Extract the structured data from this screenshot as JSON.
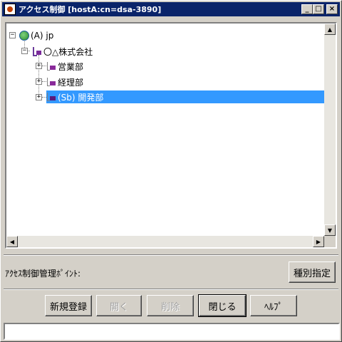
{
  "window": {
    "title": "アクセス制御 [hostA:cn=dsa-3890]",
    "minimize_glyph": "_",
    "maximize_glyph": "□",
    "close_glyph": "×"
  },
  "tree": {
    "nodes": [
      {
        "label": "(A) jp",
        "icon": "globe-icon",
        "expander": "−",
        "level": 0,
        "selected": false
      },
      {
        "label": "〇△株式会社",
        "icon": "organization-icon",
        "expander": "−",
        "level": 1,
        "selected": false
      },
      {
        "label": "営業部",
        "icon": "org-unit-icon",
        "expander": "+",
        "level": 2,
        "selected": false
      },
      {
        "label": "経理部",
        "icon": "org-unit-icon",
        "expander": "+",
        "level": 2,
        "selected": false
      },
      {
        "label": "(Sb) 開発部",
        "icon": "org-unit-icon",
        "expander": "+",
        "level": 2,
        "selected": true
      }
    ]
  },
  "scrollbar": {
    "up_glyph": "▲",
    "down_glyph": "▼",
    "left_glyph": "◀",
    "right_glyph": "▶"
  },
  "access_control": {
    "label": "ｱｸｾｽ制御管理ﾎﾟｲﾝﾄ:",
    "type_button": "種別指定"
  },
  "buttons": {
    "register": "新規登録",
    "open": "開く",
    "delete": "削除",
    "close": "閉じる",
    "help": "ﾍﾙﾌﾟ"
  },
  "status": {
    "text": ""
  }
}
